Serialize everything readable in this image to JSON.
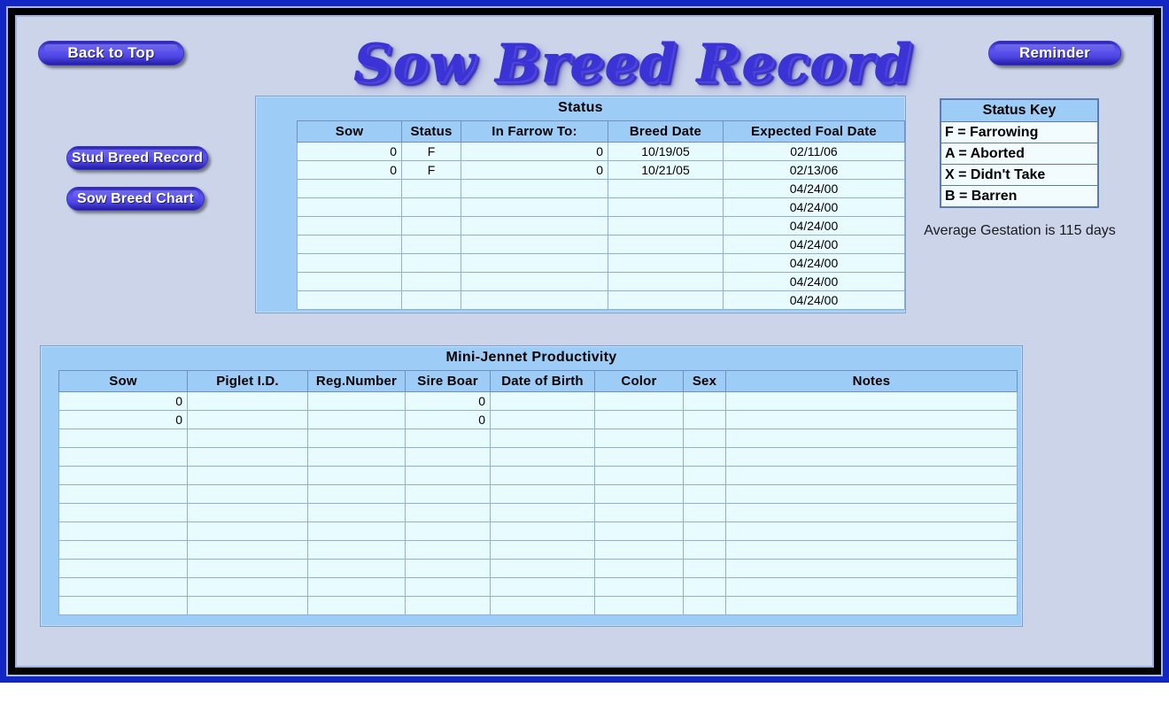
{
  "header": {
    "title": "Sow Breed Record",
    "back_to_top_label": "Back to Top",
    "reminder_label": "Reminder"
  },
  "nav_buttons": {
    "stud_breed_record_label": "Stud Breed Record",
    "sow_breed_chart_label": "Sow Breed Chart"
  },
  "status_section": {
    "title": "Status",
    "columns": [
      "Sow",
      "Status",
      "In Farrow To:",
      "Breed Date",
      "Expected Foal Date"
    ],
    "rows": [
      {
        "sow": "0",
        "status": "F",
        "in_farrow_to": "0",
        "breed_date": "10/19/05",
        "expected_foal_date": "02/11/06"
      },
      {
        "sow": "0",
        "status": "F",
        "in_farrow_to": "0",
        "breed_date": "10/21/05",
        "expected_foal_date": "02/13/06"
      },
      {
        "sow": "",
        "status": "",
        "in_farrow_to": "",
        "breed_date": "",
        "expected_foal_date": "04/24/00"
      },
      {
        "sow": "",
        "status": "",
        "in_farrow_to": "",
        "breed_date": "",
        "expected_foal_date": "04/24/00"
      },
      {
        "sow": "",
        "status": "",
        "in_farrow_to": "",
        "breed_date": "",
        "expected_foal_date": "04/24/00"
      },
      {
        "sow": "",
        "status": "",
        "in_farrow_to": "",
        "breed_date": "",
        "expected_foal_date": "04/24/00"
      },
      {
        "sow": "",
        "status": "",
        "in_farrow_to": "",
        "breed_date": "",
        "expected_foal_date": "04/24/00"
      },
      {
        "sow": "",
        "status": "",
        "in_farrow_to": "",
        "breed_date": "",
        "expected_foal_date": "04/24/00"
      },
      {
        "sow": "",
        "status": "",
        "in_farrow_to": "",
        "breed_date": "",
        "expected_foal_date": "04/24/00"
      }
    ]
  },
  "status_key": {
    "title": "Status Key",
    "entries": [
      "F = Farrowing",
      "A = Aborted",
      "X = Didn't Take",
      "B = Barren"
    ]
  },
  "gestation_note": "Average Gestation is 115 days",
  "productivity_section": {
    "title": "Mini-Jennet Productivity",
    "columns": [
      "Sow",
      "Piglet I.D.",
      "Reg.Number",
      "Sire Boar",
      "Date of Birth",
      "Color",
      "Sex",
      "Notes"
    ],
    "rows": [
      {
        "sow": "0",
        "piglet_id": "",
        "reg_number": "",
        "sire_boar": "0",
        "date_of_birth": "",
        "color": "",
        "sex": "",
        "notes": ""
      },
      {
        "sow": "0",
        "piglet_id": "",
        "reg_number": "",
        "sire_boar": "0",
        "date_of_birth": "",
        "color": "",
        "sex": "",
        "notes": ""
      },
      {
        "sow": "",
        "piglet_id": "",
        "reg_number": "",
        "sire_boar": "",
        "date_of_birth": "",
        "color": "",
        "sex": "",
        "notes": ""
      },
      {
        "sow": "",
        "piglet_id": "",
        "reg_number": "",
        "sire_boar": "",
        "date_of_birth": "",
        "color": "",
        "sex": "",
        "notes": ""
      },
      {
        "sow": "",
        "piglet_id": "",
        "reg_number": "",
        "sire_boar": "",
        "date_of_birth": "",
        "color": "",
        "sex": "",
        "notes": ""
      },
      {
        "sow": "",
        "piglet_id": "",
        "reg_number": "",
        "sire_boar": "",
        "date_of_birth": "",
        "color": "",
        "sex": "",
        "notes": ""
      },
      {
        "sow": "",
        "piglet_id": "",
        "reg_number": "",
        "sire_boar": "",
        "date_of_birth": "",
        "color": "",
        "sex": "",
        "notes": ""
      },
      {
        "sow": "",
        "piglet_id": "",
        "reg_number": "",
        "sire_boar": "",
        "date_of_birth": "",
        "color": "",
        "sex": "",
        "notes": ""
      },
      {
        "sow": "",
        "piglet_id": "",
        "reg_number": "",
        "sire_boar": "",
        "date_of_birth": "",
        "color": "",
        "sex": "",
        "notes": ""
      },
      {
        "sow": "",
        "piglet_id": "",
        "reg_number": "",
        "sire_boar": "",
        "date_of_birth": "",
        "color": "",
        "sex": "",
        "notes": ""
      },
      {
        "sow": "",
        "piglet_id": "",
        "reg_number": "",
        "sire_boar": "",
        "date_of_birth": "",
        "color": "",
        "sex": "",
        "notes": ""
      },
      {
        "sow": "",
        "piglet_id": "",
        "reg_number": "",
        "sire_boar": "",
        "date_of_birth": "",
        "color": "",
        "sex": "",
        "notes": ""
      }
    ]
  },
  "colors": {
    "frame_blue": "#1226c4",
    "page_background": "#ccd4ea",
    "panel_blue": "#9dcdf7",
    "cell_background": "#e8fbff",
    "title_blue": "#3b33d6",
    "button_blue": "#4a42dd"
  }
}
